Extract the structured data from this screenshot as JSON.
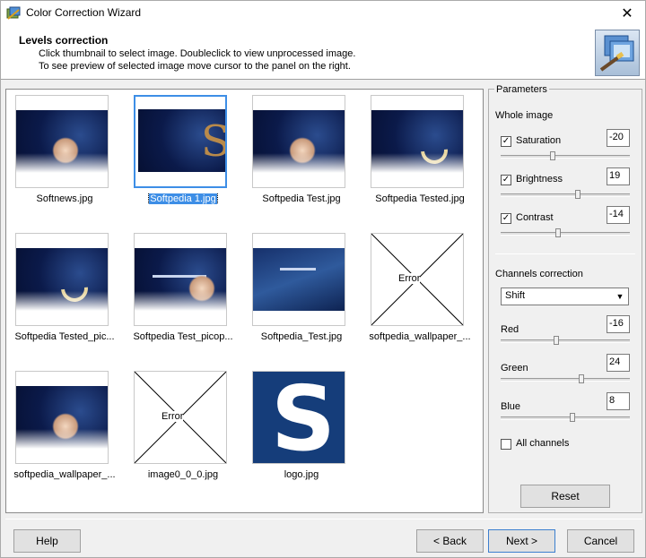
{
  "window": {
    "title": "Color Correction Wizard"
  },
  "header": {
    "title": "Levels correction",
    "line1": "Click thumbnail to select image. Doubleclick to view unprocessed image.",
    "line2": "To see preview of selected image move cursor to the panel on the right."
  },
  "thumbnails": [
    {
      "caption": "Softnews.jpg",
      "kind": "photo-person"
    },
    {
      "caption": "Softpedia 1.jpg",
      "kind": "photo-s",
      "selected": true
    },
    {
      "caption": "Softpedia Test.jpg",
      "kind": "photo-person"
    },
    {
      "caption": "Softpedia Tested.jpg",
      "kind": "photo-moon"
    },
    {
      "caption": "Softpedia Tested_pic...",
      "kind": "photo-moon"
    },
    {
      "caption": "Softpedia Test_picop...",
      "kind": "photo-text-person"
    },
    {
      "caption": "Softpedia_Test.jpg",
      "kind": "photo-text"
    },
    {
      "caption": "softpedia_wallpaper_...",
      "kind": "error"
    },
    {
      "caption": "softpedia_wallpaper_...",
      "kind": "photo-person"
    },
    {
      "caption": "image0_0_0.jpg",
      "kind": "error"
    },
    {
      "caption": "logo.jpg",
      "kind": "logo"
    }
  ],
  "error_label": "Error",
  "params": {
    "legend": "Parameters",
    "whole_image": "Whole image",
    "saturation": {
      "label": "Saturation",
      "checked": true,
      "value": "-20"
    },
    "brightness": {
      "label": "Brightness",
      "checked": true,
      "value": "19"
    },
    "contrast": {
      "label": "Contrast",
      "checked": true,
      "value": "-14"
    },
    "channels_correction": "Channels correction",
    "mode": "Shift",
    "red": {
      "label": "Red",
      "value": "-16"
    },
    "green": {
      "label": "Green",
      "value": "24"
    },
    "blue": {
      "label": "Blue",
      "value": "8"
    },
    "all_channels": "All channels",
    "reset": "Reset"
  },
  "buttons": {
    "help": "Help",
    "back": "< Back",
    "next": "Next >",
    "cancel": "Cancel"
  },
  "colors": {
    "selection": "#3d8ee6",
    "dark_blue": "#0b1a4a"
  }
}
